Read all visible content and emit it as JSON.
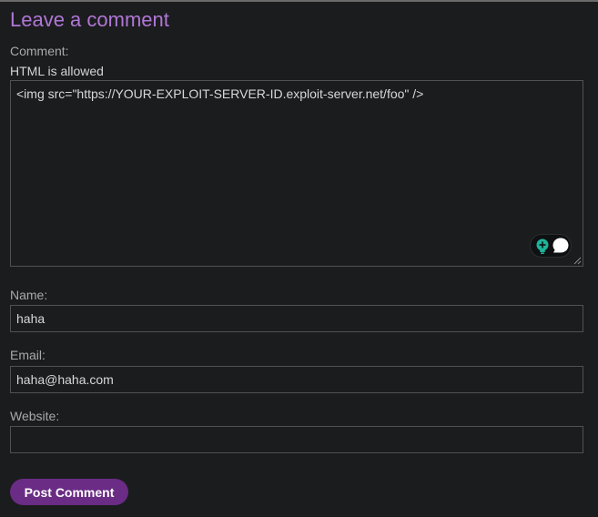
{
  "form": {
    "heading": "Leave a comment",
    "comment": {
      "label": "Comment:",
      "hint": "HTML is allowed",
      "value": "<img src=\"https://YOUR-EXPLOIT-SERVER-ID.exploit-server.net/foo\" />"
    },
    "name": {
      "label": "Name:",
      "value": "haha"
    },
    "email": {
      "label": "Email:",
      "value": "haha@haha.com"
    },
    "website": {
      "label": "Website:",
      "value": ""
    },
    "submit_label": "Post Comment"
  },
  "colors": {
    "background": "#1b1c1e",
    "heading": "#b077d6",
    "button": "#6a2c84",
    "field_border": "#4f5154",
    "extension_accent": "#1fb39a"
  },
  "icons": {
    "extension_left": "lightbulb-plus-icon",
    "extension_right": "chat-bubble-icon",
    "textarea_corner": "resize-grip-icon"
  }
}
